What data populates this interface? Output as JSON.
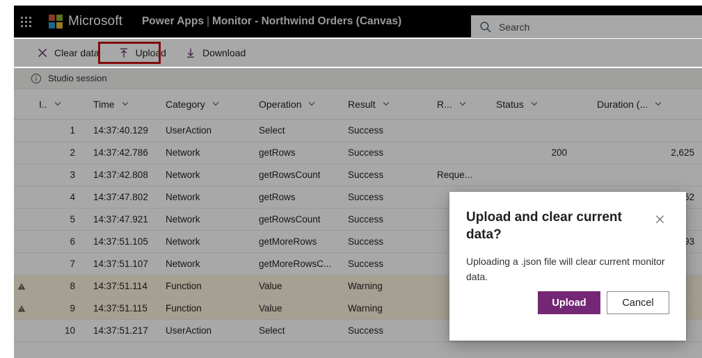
{
  "header": {
    "waffle_label": "app-launcher",
    "brand": "Microsoft",
    "product": "Power Apps",
    "separator": "|",
    "title": "Monitor - Northwind Orders (Canvas)",
    "search_placeholder": "Search",
    "search_value": ""
  },
  "toolbar": {
    "buttons": [
      {
        "label": "Clear data",
        "icon": "close-x-icon"
      },
      {
        "label": "Upload",
        "icon": "upload-arrow-icon"
      },
      {
        "label": "Download",
        "icon": "download-arrow-icon"
      }
    ],
    "highlight_target": "Upload",
    "highlight_color": "#ff0000"
  },
  "session": {
    "icon": "info-circle-icon",
    "label": "Studio session"
  },
  "grid": {
    "columns": [
      {
        "key": "id",
        "label": "I..",
        "sortable": true
      },
      {
        "key": "time",
        "label": "Time",
        "sortable": true
      },
      {
        "key": "category",
        "label": "Category",
        "sortable": true
      },
      {
        "key": "operation",
        "label": "Operation",
        "sortable": true
      },
      {
        "key": "result",
        "label": "Result",
        "sortable": true
      },
      {
        "key": "request",
        "label": "R...",
        "sortable": true
      },
      {
        "key": "status",
        "label": "Status",
        "sortable": true
      },
      {
        "key": "duration",
        "label": "Duration (...",
        "sortable": true
      }
    ],
    "rows": [
      {
        "flag": "",
        "id": "1",
        "time": "14:37:40.129",
        "category": "UserAction",
        "operation": "Select",
        "result": "Success",
        "request": "",
        "status": "",
        "duration": "",
        "severity": "normal"
      },
      {
        "flag": "",
        "id": "2",
        "time": "14:37:42.786",
        "category": "Network",
        "operation": "getRows",
        "result": "Success",
        "request": "",
        "status": "200",
        "duration": "2,625",
        "severity": "normal"
      },
      {
        "flag": "",
        "id": "3",
        "time": "14:37:42.808",
        "category": "Network",
        "operation": "getRowsCount",
        "result": "Success",
        "request": "Reque...",
        "status": "",
        "duration": "",
        "severity": "normal"
      },
      {
        "flag": "",
        "id": "4",
        "time": "14:37:47.802",
        "category": "Network",
        "operation": "getRows",
        "result": "Success",
        "request": "",
        "status": "",
        "duration": "62",
        "severity": "normal"
      },
      {
        "flag": "",
        "id": "5",
        "time": "14:37:47.921",
        "category": "Network",
        "operation": "getRowsCount",
        "result": "Success",
        "request": "",
        "status": "",
        "duration": "",
        "severity": "normal"
      },
      {
        "flag": "",
        "id": "6",
        "time": "14:37:51.105",
        "category": "Network",
        "operation": "getMoreRows",
        "result": "Success",
        "request": "",
        "status": "",
        "duration": "93",
        "severity": "normal"
      },
      {
        "flag": "",
        "id": "7",
        "time": "14:37:51.107",
        "category": "Network",
        "operation": "getMoreRowsC...",
        "result": "Success",
        "request": "",
        "status": "",
        "duration": "",
        "severity": "normal"
      },
      {
        "flag": "warning-triangle-icon",
        "id": "8",
        "time": "14:37:51.114",
        "category": "Function",
        "operation": "Value",
        "result": "Warning",
        "request": "",
        "status": "",
        "duration": "",
        "severity": "warning"
      },
      {
        "flag": "warning-triangle-icon",
        "id": "9",
        "time": "14:37:51.115",
        "category": "Function",
        "operation": "Value",
        "result": "Warning",
        "request": "",
        "status": "",
        "duration": "",
        "severity": "warning"
      },
      {
        "flag": "",
        "id": "10",
        "time": "14:37:51.217",
        "category": "UserAction",
        "operation": "Select",
        "result": "Success",
        "request": "",
        "status": "",
        "duration": "",
        "severity": "normal"
      }
    ]
  },
  "dialog": {
    "title": "Upload and clear current data?",
    "body": "Uploading a .json file will clear current monitor data.",
    "primary_label": "Upload",
    "secondary_label": "Cancel",
    "close_icon": "close-x-icon",
    "primary_color": "#742774"
  }
}
